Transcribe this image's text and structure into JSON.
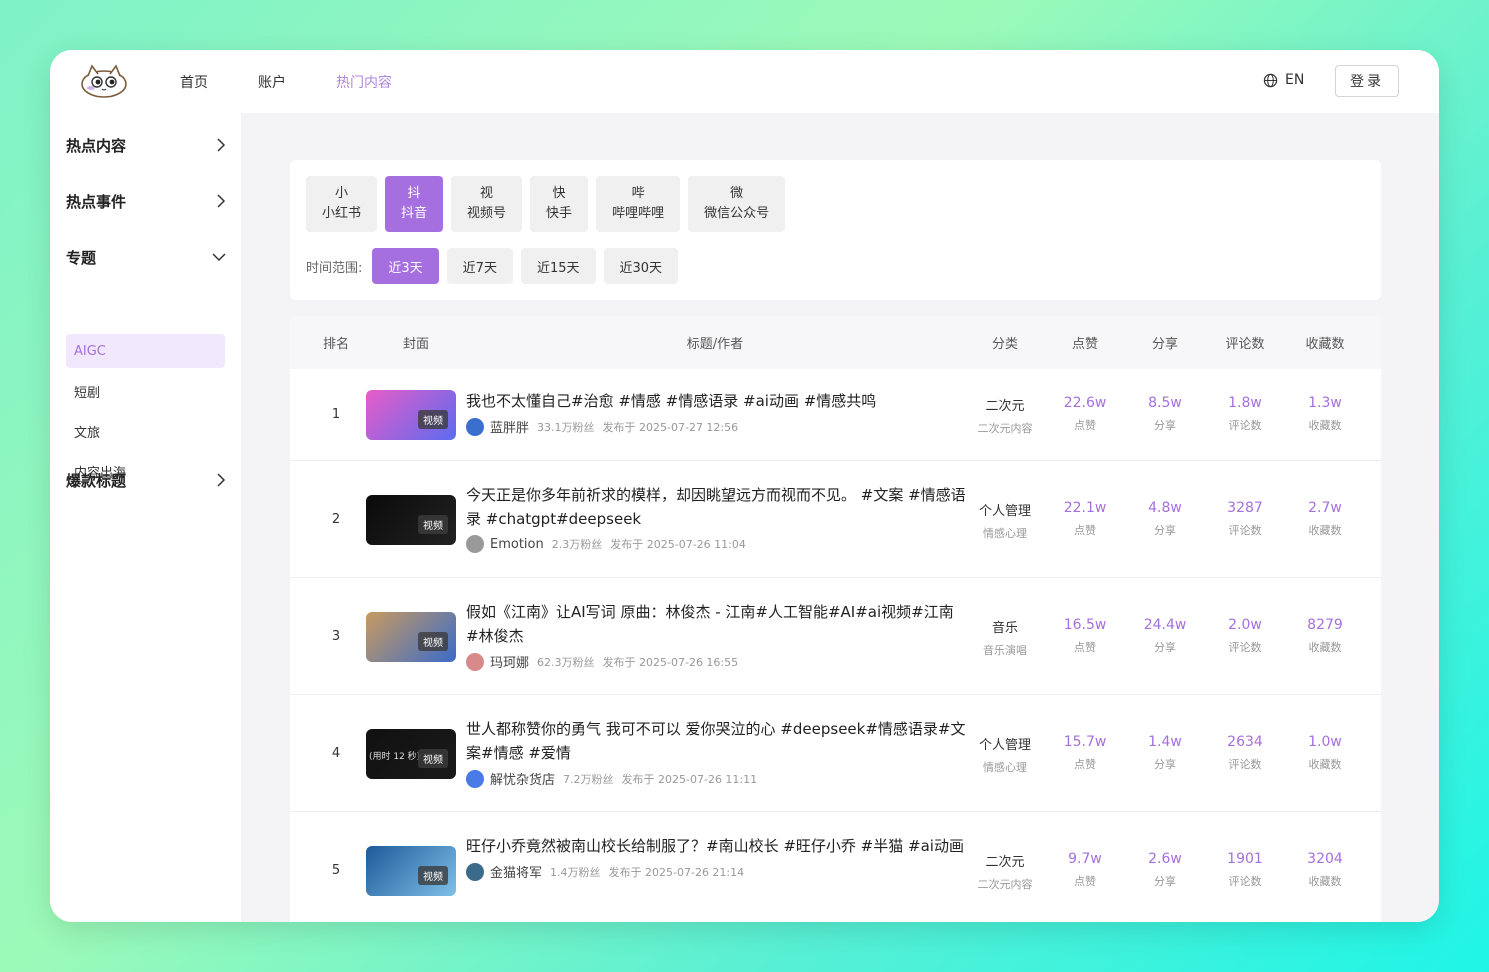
{
  "nav": {
    "items": [
      {
        "label": "首页",
        "active": false
      },
      {
        "label": "账户",
        "active": false
      },
      {
        "label": "热门内容",
        "active": true
      }
    ],
    "lang": "EN",
    "login": "登录"
  },
  "sidebar": {
    "groups": [
      {
        "label": "热点内容",
        "chevron": "chevron-right-icon"
      },
      {
        "label": "热点事件",
        "chevron": "chevron-right-icon"
      },
      {
        "label": "专题",
        "chevron": "chevron-down-icon"
      },
      {
        "label": "爆款标题",
        "chevron": "chevron-right-icon"
      }
    ],
    "sub_items": [
      "AIGC",
      "短剧",
      "文旅",
      "内容出海"
    ],
    "active_sub": "AIGC"
  },
  "filters": {
    "platforms": [
      {
        "char": "小",
        "label": "小红书"
      },
      {
        "char": "抖",
        "label": "抖音"
      },
      {
        "char": "视",
        "label": "视频号"
      },
      {
        "char": "快",
        "label": "快手"
      },
      {
        "char": "哔",
        "label": "哔哩哔哩"
      },
      {
        "char": "微",
        "label": "微信公众号"
      }
    ],
    "active_platform": "抖音",
    "time_label": "时间范围:",
    "time_options": [
      "近3天",
      "近7天",
      "近15天",
      "近30天"
    ],
    "active_time": "近3天"
  },
  "table": {
    "headers": {
      "rank": "排名",
      "cover": "封面",
      "title": "标题/作者",
      "category": "分类",
      "likes": "点赞",
      "shares": "分享",
      "comments": "评论数",
      "favorites": "收藏数"
    },
    "cover_badge": "视频",
    "likes_label": "点赞",
    "shares_label": "分享",
    "comments_label": "评论数",
    "favorites_label": "收藏数",
    "rows": [
      {
        "rank": "1",
        "title": "我也不太懂自己#治愈 #情感 #情感语录 #ai动画 #情感共鸣",
        "author": "蓝胖胖",
        "fans": "33.1万粉丝",
        "published": "发布于 2025-07-27 12:56",
        "cat_main": "二次元",
        "cat_sub": "二次元内容",
        "likes": "22.6w",
        "shares": "8.5w",
        "comments": "1.8w",
        "favorites": "1.3w",
        "cover_colors": [
          "#e85cc8",
          "#5a6cf0"
        ],
        "avatar_color": "#3a6fd0"
      },
      {
        "rank": "2",
        "title": "今天正是你多年前祈求的模样，却因眺望远方而视而不见。 #文案 #情感语录 #chatgpt#deepseek",
        "author": "Emotion",
        "fans": "2.3万粉丝",
        "published": "发布于 2025-07-26 11:04",
        "cat_main": "个人管理",
        "cat_sub": "情感心理",
        "likes": "22.1w",
        "shares": "4.8w",
        "comments": "3287",
        "favorites": "2.7w",
        "cover_colors": [
          "#0a0a0a",
          "#222222"
        ],
        "avatar_color": "#9a9a9a"
      },
      {
        "rank": "3",
        "title": "假如《江南》让AI写词 原曲：林俊杰 - 江南#人工智能#AI#ai视频#江南 #林俊杰",
        "author": "玛珂娜",
        "fans": "62.3万粉丝",
        "published": "发布于 2025-07-26 16:55",
        "cat_main": "音乐",
        "cat_sub": "音乐演唱",
        "likes": "16.5w",
        "shares": "24.4w",
        "comments": "2.0w",
        "favorites": "8279",
        "cover_colors": [
          "#c89a60",
          "#3b6cc8"
        ],
        "avatar_color": "#d88a8a"
      },
      {
        "rank": "4",
        "title": "世人都称赞你的勇气 我可不可以 爱你哭泣的心 #deepseek#情感语录#文案#情感 #爱情",
        "author": "解忧杂货店",
        "fans": "7.2万粉丝",
        "published": "发布于 2025-07-26 11:11",
        "cat_main": "个人管理",
        "cat_sub": "情感心理",
        "likes": "15.7w",
        "shares": "1.4w",
        "comments": "2634",
        "favorites": "1.0w",
        "cover_colors": [
          "#111111",
          "#1a1a1a"
        ],
        "avatar_color": "#4a7ae8",
        "cover_text": "(用时 12 秒)"
      },
      {
        "rank": "5",
        "title": "旺仔小乔竟然被南山校长给制服了？#南山校长 #旺仔小乔 #半猫 #ai动画",
        "author": "金猫将军",
        "fans": "1.4万粉丝",
        "published": "发布于 2025-07-26 21:14",
        "cat_main": "二次元",
        "cat_sub": "二次元内容",
        "likes": "9.7w",
        "shares": "2.6w",
        "comments": "1901",
        "favorites": "3204",
        "cover_colors": [
          "#1e5a9a",
          "#7fc0e8"
        ],
        "avatar_color": "#3b6a8a"
      }
    ]
  }
}
